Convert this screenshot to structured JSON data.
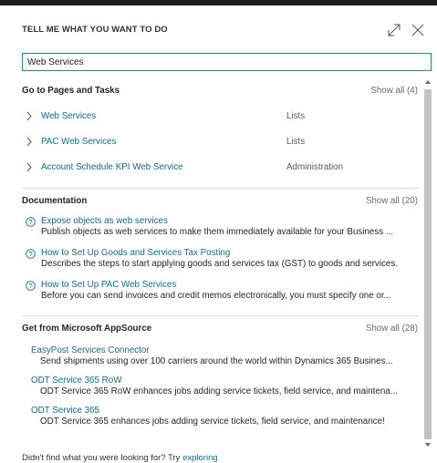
{
  "header": {
    "title": "TELL ME WHAT YOU WANT TO DO",
    "expand_icon": "expand-icon",
    "close_icon": "close-icon"
  },
  "search": {
    "value": "Web Services"
  },
  "pages_section": {
    "title": "Go to Pages and Tasks",
    "show_all": "Show all (4)",
    "items": [
      {
        "label": "Web Services",
        "category": "Lists"
      },
      {
        "label": "PAC Web Services",
        "category": "Lists"
      },
      {
        "label": "Account Schedule KPI Web Service",
        "category": "Administration"
      }
    ]
  },
  "docs_section": {
    "title": "Documentation",
    "show_all": "Show all (20)",
    "items": [
      {
        "title": "Expose objects as web services",
        "desc": "Publish objects as web services to make them immediately available for your Business ..."
      },
      {
        "title": "How to Set Up Goods and Services Tax Posting",
        "desc": "Describes the steps to start applying goods and services tax (GST) to goods and services."
      },
      {
        "title": "How to Set Up PAC Web Services",
        "desc": "Before you can send invoices and credit memos electronically, you must specify one or..."
      }
    ]
  },
  "apps_section": {
    "title": "Get from Microsoft AppSource",
    "show_all": "Show all (28)",
    "items": [
      {
        "title": "EasyPost Services Connector",
        "desc": "Send shipments using over 100 carriers around the world within Dynamics 365 Busines..."
      },
      {
        "title": "ODT Service 365 RoW",
        "desc": "ODT Service 365 RoW enhances jobs adding service tickets, field service, and maintena..."
      },
      {
        "title": "ODT Service 365",
        "desc": "ODT Service 365 enhances jobs adding service tickets, field service, and maintenance!"
      }
    ]
  },
  "footer": {
    "text": "Didn't find what you were looking for? Try ",
    "link": "exploring"
  },
  "colors": {
    "accent": "#1d8f84",
    "link": "#0f6f92",
    "topbar": "#1e1e1e"
  }
}
